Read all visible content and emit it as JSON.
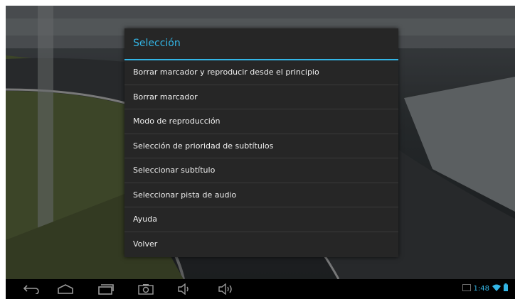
{
  "dialog": {
    "title": "Selección",
    "items": [
      {
        "label": "Borrar marcador y reproducir desde el principio"
      },
      {
        "label": "Borrar marcador"
      },
      {
        "label": "Modo de reproducción"
      },
      {
        "label": "Selección de prioridad de subtítulos"
      },
      {
        "label": "Seleccionar subtítulo"
      },
      {
        "label": "Seleccionar pista de audio"
      },
      {
        "label": "Ayuda"
      },
      {
        "label": "Volver"
      }
    ]
  },
  "navbar": {
    "icons": [
      "back-icon",
      "home-icon",
      "recent-apps-icon",
      "screenshot-icon",
      "volume-down-icon",
      "volume-up-icon"
    ],
    "status": {
      "time": "1:48",
      "icons": [
        "notification-icon",
        "wifi-icon",
        "battery-icon"
      ]
    }
  },
  "colors": {
    "accent": "#33b5e5",
    "dialog_bg": "#262626",
    "text": "#f0f0f0"
  }
}
